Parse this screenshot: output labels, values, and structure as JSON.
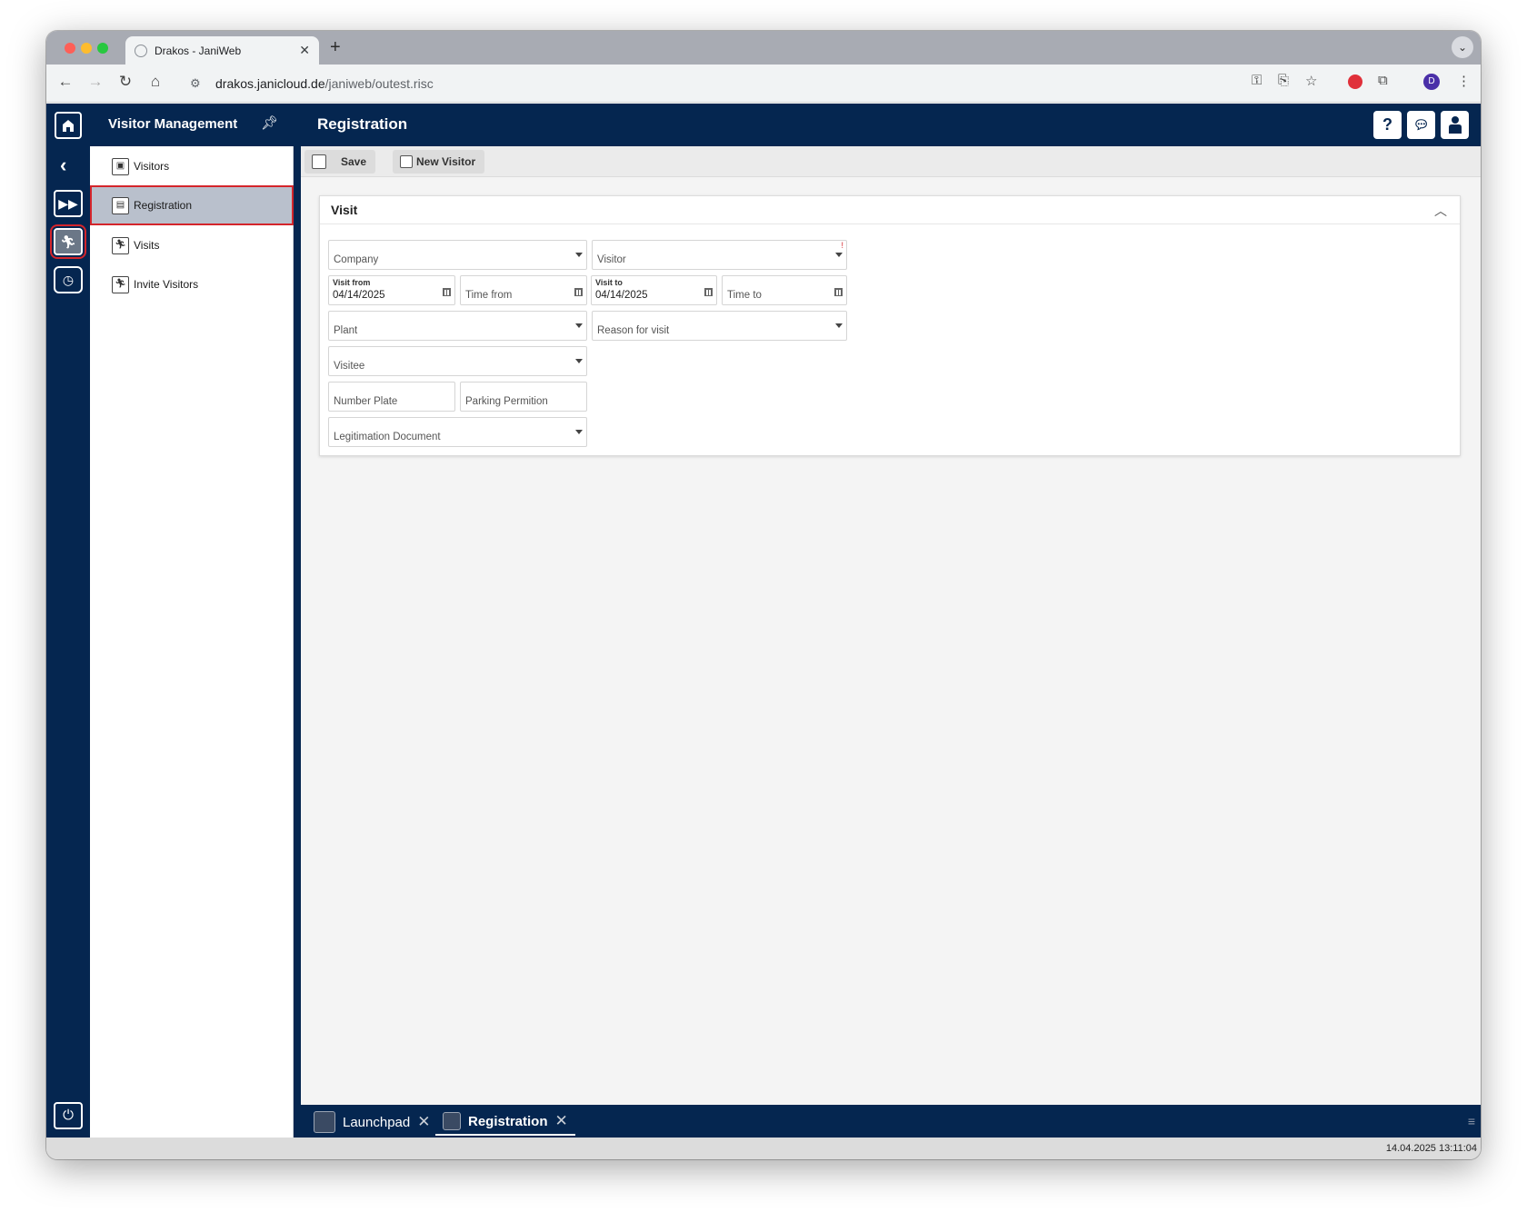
{
  "browser": {
    "tab_title": "Drakos - JaniWeb",
    "url_host": "drakos.janicloud.de",
    "url_path": "/janiweb/outest.risc",
    "avatar_letter": "D"
  },
  "header": {
    "module_title": "Visitor Management",
    "page_title": "Registration"
  },
  "nav": {
    "items": [
      {
        "label": "Visitors"
      },
      {
        "label": "Registration"
      },
      {
        "label": "Visits"
      },
      {
        "label": "Invite Visitors"
      }
    ]
  },
  "commands": {
    "save_label": "Save",
    "new_visitor_label": "New Visitor"
  },
  "visit": {
    "title": "Visit",
    "company_placeholder": "Company",
    "visitor_placeholder": "Visitor",
    "visit_from_label": "Visit from",
    "visit_from_value": "04/14/2025",
    "time_from_placeholder": "Time from",
    "visit_to_label": "Visit to",
    "visit_to_value": "04/14/2025",
    "time_to_placeholder": "Time to",
    "plant_placeholder": "Plant",
    "reason_placeholder": "Reason for visit",
    "visitee_placeholder": "Visitee",
    "number_plate_placeholder": "Number Plate",
    "parking_placeholder": "Parking Permition",
    "legitimation_placeholder": "Legitimation Document"
  },
  "taskbar": {
    "tabs": [
      {
        "label": "Launchpad"
      },
      {
        "label": "Registration"
      }
    ]
  },
  "status": {
    "timestamp": "14.04.2025 13:11:04"
  },
  "colors": {
    "brand_navy": "#052650",
    "highlight_red": "#d4252b",
    "active_nav": "#b9c0cc"
  }
}
